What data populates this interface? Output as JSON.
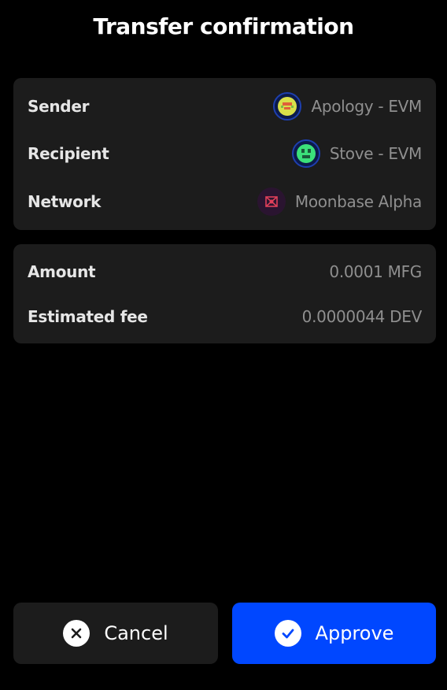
{
  "header": {
    "title": "Transfer confirmation"
  },
  "details": {
    "sender": {
      "label": "Sender",
      "value": "Apology - EVM",
      "icon": "sender-avatar-icon"
    },
    "recipient": {
      "label": "Recipient",
      "value": "Stove - EVM",
      "icon": "recipient-avatar-icon"
    },
    "network": {
      "label": "Network",
      "value": "Moonbase Alpha",
      "icon": "moonbase-alpha-icon"
    }
  },
  "amounts": {
    "amount": {
      "label": "Amount",
      "value": "0.0001 MFG"
    },
    "fee": {
      "label": "Estimated fee",
      "value": "0.0000044 DEV"
    }
  },
  "actions": {
    "cancel_label": "Cancel",
    "cancel_icon": "close-icon",
    "approve_label": "Approve",
    "approve_icon": "check-icon"
  },
  "colors": {
    "background": "#000000",
    "card": "#1c1c1c",
    "approve": "#0047ff",
    "value_text": "#8f8f8f"
  }
}
